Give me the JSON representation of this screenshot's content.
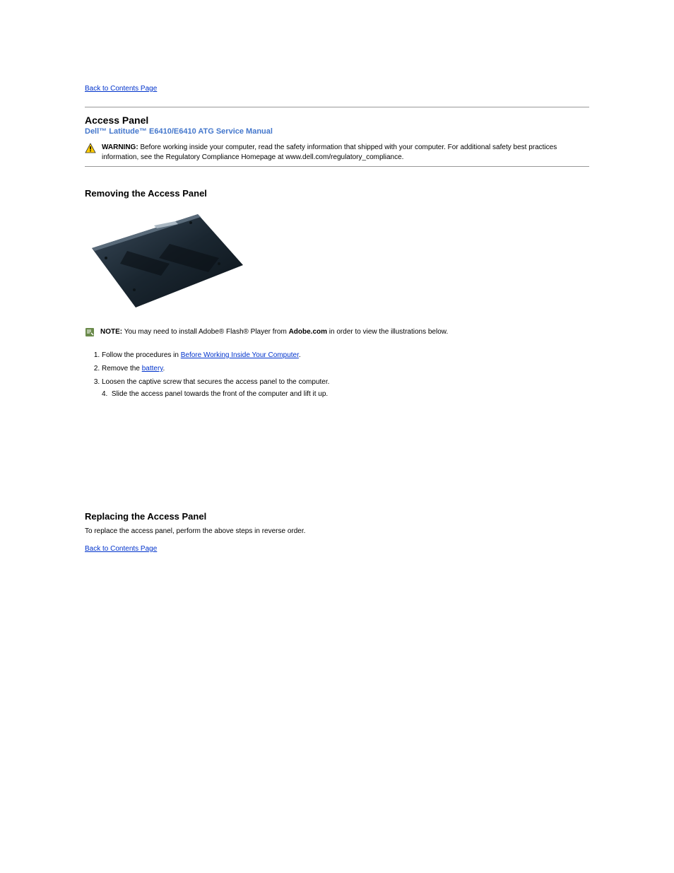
{
  "nav": {
    "back_top": "Back to Contents Page",
    "back_bottom": "Back to Contents Page"
  },
  "header": {
    "page_title": "Access Panel",
    "manual_title": "Dell™ Latitude™ E6410/E6410 ATG Service Manual"
  },
  "warning": {
    "label": "WARNING:",
    "text": "Before working inside your computer, read the safety information that shipped with your computer. For additional safety best practices information, see the Regulatory Compliance Homepage at www.dell.com/regulatory_compliance."
  },
  "remove": {
    "heading": "Removing the Access Panel"
  },
  "note": {
    "label": "NOTE:",
    "text_before": "You may need to install Adobe",
    "reg1": "®",
    "text_mid": " Flash",
    "reg2": "®",
    "text_after_before_link": " Player from ",
    "link_text": "Adobe.com",
    "text_after_link": " in order to view the illustrations below."
  },
  "steps": {
    "s1_pre": "Follow the procedures in ",
    "s1_link": "Before Working Inside Your Computer",
    "s1_post": ".",
    "s2_pre": "Remove the ",
    "s2_link": "battery",
    "s2_post": ".",
    "s3": "Loosen the captive screw that secures the access panel to the computer.",
    "s4": "Slide the access panel towards the front of the computer and lift it up."
  },
  "replace": {
    "heading": "Replacing the Access Panel",
    "text": "To replace the access panel, perform the above steps in reverse order."
  }
}
